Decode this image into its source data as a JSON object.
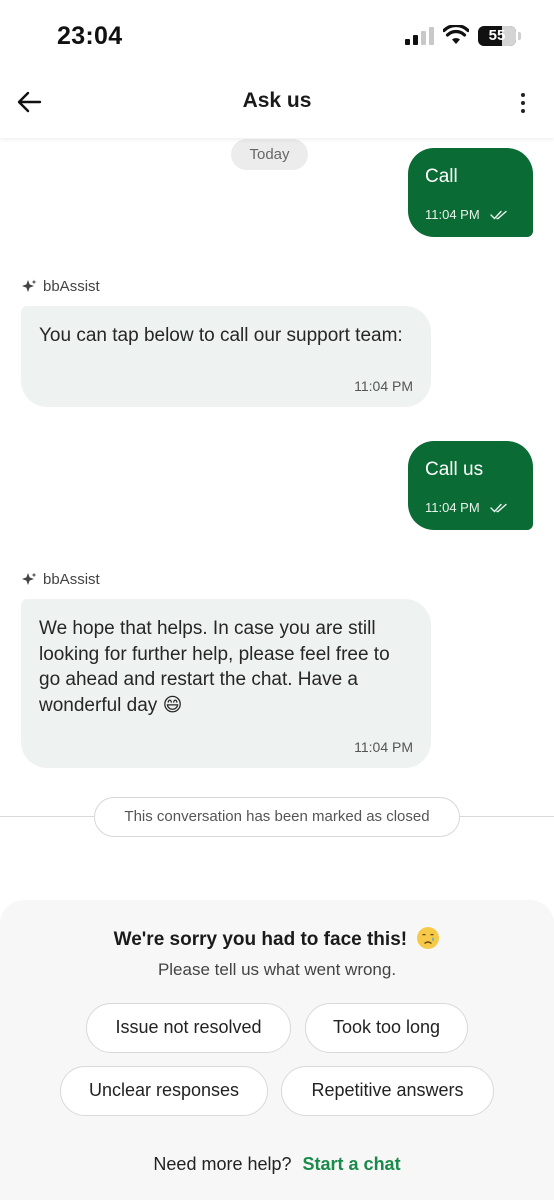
{
  "status_bar": {
    "time": "23:04",
    "battery_level": "55"
  },
  "header": {
    "title": "Ask us"
  },
  "chat": {
    "date_chip": "Today",
    "messages": [
      {
        "type": "out",
        "text": "Call",
        "time": "11:04 PM"
      },
      {
        "type": "in",
        "sender": "bbAssist",
        "text": "You can tap below to call our support team:",
        "time": "11:04 PM"
      },
      {
        "type": "out",
        "text": "Call us",
        "time": "11:04 PM"
      },
      {
        "type": "in",
        "sender": "bbAssist",
        "text": "We hope that helps. In case you are still looking for further help, please feel free to go ahead and restart the chat. Have a wonderful day 😄",
        "time": "11:04 PM"
      }
    ],
    "closed_notice": "This conversation has been marked as closed"
  },
  "feedback": {
    "title": "We're sorry you had to face this!",
    "subtitle": "Please tell us what went wrong.",
    "options": [
      "Issue not resolved",
      "Took too long",
      "Unclear responses",
      "Repetitive answers"
    ],
    "help_text": "Need more help?",
    "help_link": "Start a chat"
  },
  "colors": {
    "brand_green": "#0b6b35",
    "link_green": "#1a8a4a",
    "bubble_in": "#eef3f1"
  },
  "icons": [
    "back-arrow-icon",
    "more-vertical-icon",
    "sparkle-icon",
    "double-check-icon",
    "crying-face-icon",
    "signal-icon",
    "wifi-icon",
    "battery-icon"
  ]
}
